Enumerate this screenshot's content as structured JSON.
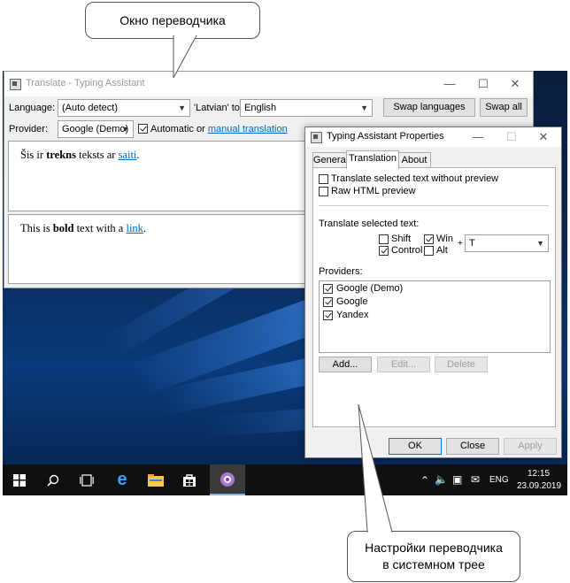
{
  "callouts": {
    "top": "Окно переводчика",
    "bottom_line1": "Настройки переводчика",
    "bottom_line2": "в системном трее"
  },
  "main_window": {
    "title": "Translate - Typing Assistant",
    "language_label": "Language:",
    "source_language": "(Auto detect)",
    "detected_to_label": "'Latvian' to",
    "target_language": "English",
    "swap_languages": "Swap languages",
    "swap_all": "Swap all",
    "provider_label": "Provider:",
    "provider": "Google (Demo)",
    "automatic_or": "Automatic or",
    "manual_translation": "manual translation",
    "source_text": {
      "before": "Šis ir ",
      "bold": "trekns",
      "middle": " teksts ar ",
      "link": "saiti",
      "after": "."
    },
    "result_text": {
      "before": "This is ",
      "bold": "bold",
      "middle": " text with a ",
      "link": "link",
      "after": "."
    }
  },
  "properties": {
    "title": "Typing Assistant Properties",
    "tabs": [
      "General",
      "Translation",
      "About"
    ],
    "active_tab": "Translation",
    "opt_without_preview": "Translate selected text without preview",
    "opt_raw_html": "Raw HTML preview",
    "hotkey_label": "Translate selected text:",
    "mod_shift": "Shift",
    "mod_win": "Win",
    "mod_control": "Control",
    "mod_alt": "Alt",
    "plus": "+",
    "key": "T",
    "providers_label": "Providers:",
    "providers": [
      "Google (Demo)",
      "Google",
      "Yandex"
    ],
    "add": "Add...",
    "edit": "Edit...",
    "delete": "Delete",
    "ok": "OK",
    "close": "Close",
    "apply": "Apply"
  },
  "taskbar": {
    "language": "ENG",
    "time": "12:15",
    "date": "23.09.2019"
  },
  "icons": [
    "windows-start-icon",
    "search-icon",
    "task-view-icon",
    "edge-icon",
    "file-explorer-icon",
    "store-icon",
    "typing-assistant-icon",
    "chevron-up-icon",
    "volume-icon",
    "network-icon",
    "notification-icon"
  ]
}
